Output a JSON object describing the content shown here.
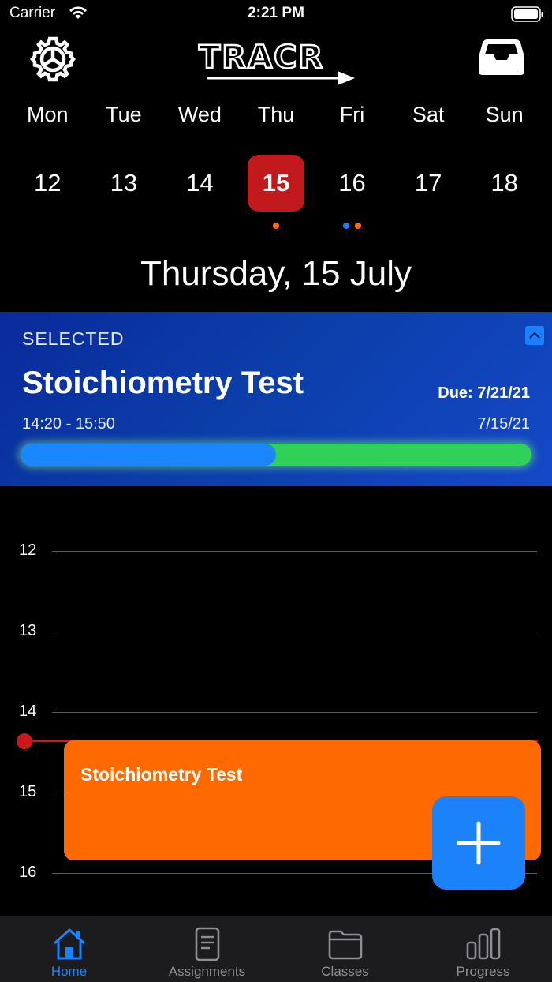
{
  "status_bar": {
    "carrier": "Carrier",
    "time": "2:21 PM"
  },
  "header": {
    "logo_text": "TRACR",
    "settings_icon": "gear-icon",
    "inbox_icon": "inbox-icon"
  },
  "week": [
    {
      "name": "Mon",
      "num": "12",
      "selected": false,
      "dots": []
    },
    {
      "name": "Tue",
      "num": "13",
      "selected": false,
      "dots": []
    },
    {
      "name": "Wed",
      "num": "14",
      "selected": false,
      "dots": []
    },
    {
      "name": "Thu",
      "num": "15",
      "selected": true,
      "dots": [
        "#ff6a00"
      ]
    },
    {
      "name": "Fri",
      "num": "16",
      "selected": false,
      "dots": [
        "#1b82fa",
        "#ff6a00"
      ]
    },
    {
      "name": "Sat",
      "num": "17",
      "selected": false,
      "dots": []
    },
    {
      "name": "Sun",
      "num": "18",
      "selected": false,
      "dots": []
    }
  ],
  "date_title": "Thursday, 15 July",
  "selected_card": {
    "label": "SELECTED",
    "title": "Stoichiometry Test",
    "due": "Due: 7/21/21",
    "time_range": "14:20 - 15:50",
    "date": "7/15/21",
    "progress_fraction": 0.5
  },
  "timeline": {
    "hours": [
      "12",
      "13",
      "14",
      "15",
      "16"
    ],
    "event_title": "Stoichiometry Test",
    "now_color": "#c9181c",
    "event_color": "#ff6a00"
  },
  "tabs": [
    {
      "label": "Home",
      "icon": "home-icon",
      "active": true
    },
    {
      "label": "Assignments",
      "icon": "document-icon",
      "active": false
    },
    {
      "label": "Classes",
      "icon": "folder-icon",
      "active": false
    },
    {
      "label": "Progress",
      "icon": "bar-chart-icon",
      "active": false
    }
  ],
  "colors": {
    "accent": "#1b82fa",
    "selected_day": "#c2191d",
    "progress_done": "#1a86ff",
    "progress_remaining": "#30d158"
  }
}
